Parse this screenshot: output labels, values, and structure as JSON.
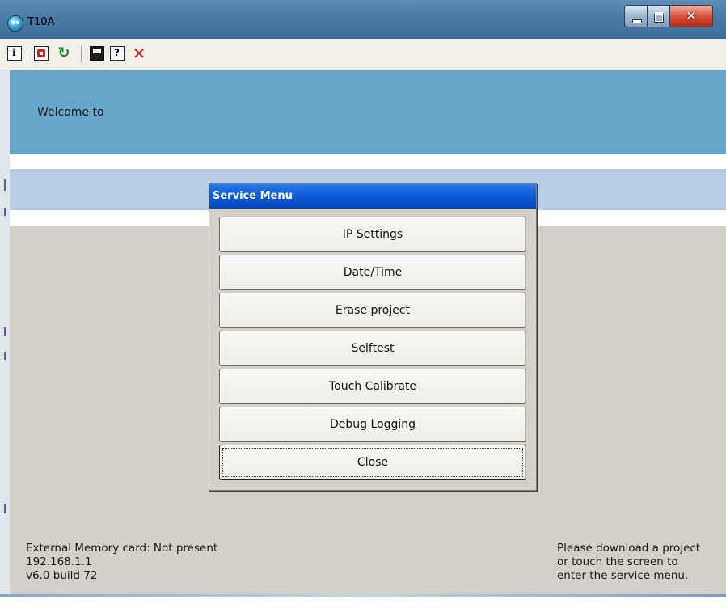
{
  "window": {
    "title": "T10A",
    "controls": {
      "minimize": "minimize",
      "maximize": "maximize",
      "close": "✕"
    }
  },
  "toolbar": {
    "icons": [
      "info-icon",
      "transfer-icon",
      "refresh-icon",
      "save-icon",
      "help-icon",
      "delete-icon"
    ]
  },
  "banner": {
    "welcome_text": "Welcome to"
  },
  "dialog": {
    "title": "Service Menu",
    "buttons": [
      "IP Settings",
      "Date/Time",
      "Erase project",
      "Selftest",
      "Touch Calibrate",
      "Debug Logging",
      "Close"
    ]
  },
  "status": {
    "memory_card": "External Memory card: Not present",
    "ip_address": "192.168.1.1",
    "version": "v6.0 build 72"
  },
  "hint": {
    "lines": [
      "Please download a project",
      "or touch the screen to",
      "enter the service menu."
    ]
  },
  "colors": {
    "banner": "#65a6c9",
    "dialog_title": "#0a59d6",
    "content_bg": "#d4d0c8",
    "band": "#b9cde2"
  }
}
